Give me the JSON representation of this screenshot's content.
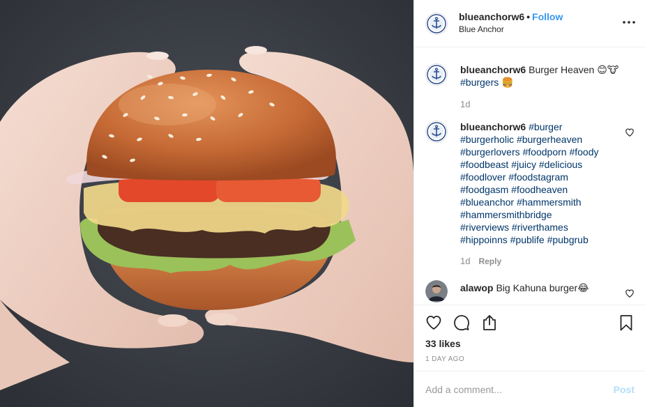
{
  "post": {
    "author": {
      "username": "blueanchorw6",
      "location": "Blue Anchor",
      "follow_label": "Follow",
      "separator": "•"
    },
    "image": {
      "icon": "burger-photo"
    },
    "caption": {
      "username": "blueanchorw6",
      "text": "Burger Heaven 😊🐮",
      "tags": [
        "#burgers"
      ],
      "tags_suffix": " 🍔",
      "time": "1d"
    },
    "comments": [
      {
        "username": "blueanchorw6",
        "tags": [
          "#burger",
          "#burgerholic",
          "#burgerheaven",
          "#burgerlovers",
          "#foodporn",
          "#foody",
          "#foodbeast",
          "#juicy",
          "#delicious",
          "#foodlover",
          "#foodstagram",
          "#foodgasm",
          "#foodheaven",
          "#blueanchor",
          "#hammersmith",
          "#hammersmithbridge",
          "#riverviews",
          "#riverthames",
          "#hippoinns",
          "#publife",
          "#pubgrub"
        ],
        "time": "1d",
        "reply_label": "Reply"
      },
      {
        "username": "alawop",
        "text": "Big Kahuna burger😂"
      }
    ],
    "likes": "33 likes",
    "date": "1 DAY AGO",
    "add_comment_placeholder": "Add a comment...",
    "post_label": "Post"
  },
  "icons": {
    "more": "more-options-icon",
    "like": "heart-icon",
    "comment": "comment-icon",
    "share": "share-icon",
    "save": "bookmark-icon"
  },
  "colors": {
    "link": "#3897f0",
    "hashtag": "#003569",
    "muted": "#8e8e8e",
    "post_disabled": "#b2dffc",
    "border": "#efefef"
  }
}
